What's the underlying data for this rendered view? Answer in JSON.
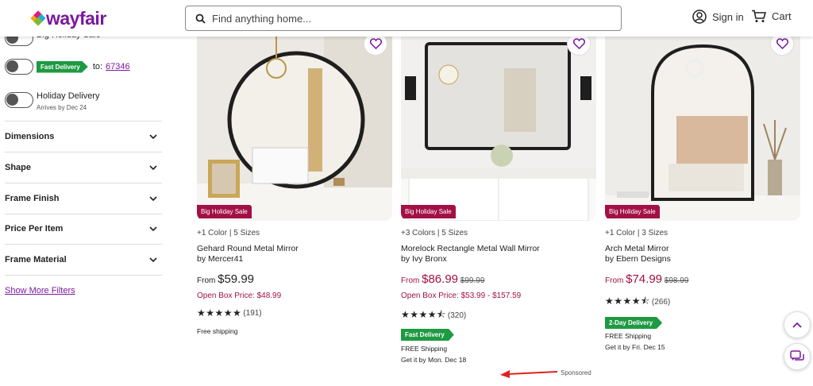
{
  "header": {
    "logo": "wayfair",
    "search_placeholder": "Find anything home...",
    "sign_in": "Sign in",
    "cart": "Cart"
  },
  "sidebar": {
    "toggles": [
      {
        "label": "Big Holiday Sale"
      },
      {
        "badge": "Fast Delivery",
        "zip_prefix": "to:",
        "zip": "67346"
      },
      {
        "label": "Holiday Delivery",
        "sub": "Arrives by Dec 24"
      }
    ],
    "filters": [
      "Dimensions",
      "Shape",
      "Frame Finish",
      "Price Per Item",
      "Frame Material"
    ],
    "show_more": "Show More Filters"
  },
  "products": [
    {
      "promo": "Big Holiday Sale",
      "meta": "+1 Color | 5 Sizes",
      "name": "Gehard Round Metal Mirror",
      "brand": "by Mercer41",
      "price_prefix": "From",
      "price": "$59.99",
      "was_price": "",
      "open_box": "Open Box Price: $48.99",
      "stars": "★★★★★",
      "rating_count": "(191)",
      "delivery_badge": "",
      "shipping": "Free shipping",
      "shipping_date": ""
    },
    {
      "promo": "Big Holiday Sale",
      "meta": "+3 Colors | 5 Sizes",
      "name": "Morelock Rectangle Metal Wall Mirror",
      "brand": "by Ivy Bronx",
      "price_prefix": "From",
      "price": "$86.99",
      "was_price": "$99.99",
      "open_box": "Open Box Price: $53.99 - $157.59",
      "stars": "★★★★⯪",
      "rating_count": "(320)",
      "delivery_badge": "Fast Delivery",
      "shipping": "FREE Shipping",
      "shipping_date": "Get it by Mon. Dec 18"
    },
    {
      "promo": "Big Holiday Sale",
      "meta": "+1 Color | 3 Sizes",
      "name": "Arch Metal Mirror",
      "brand": "by Ebern Designs",
      "price_prefix": "From",
      "price": "$74.99",
      "was_price": "$98.99",
      "open_box": "",
      "stars": "★★★★⯪",
      "rating_count": "(266)",
      "delivery_badge": "2-Day Delivery",
      "shipping": "FREE Shipping",
      "shipping_date": "Get it by Fri. Dec 15"
    }
  ],
  "sponsored": "Sponsored",
  "colors": {
    "brand": "#7b189f",
    "sale": "#a31045",
    "delivery": "#1e9a42"
  }
}
